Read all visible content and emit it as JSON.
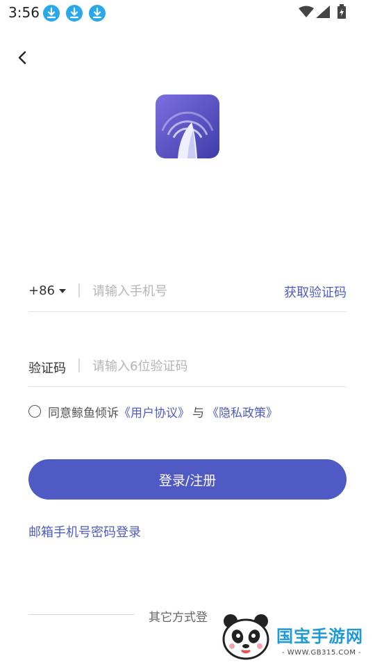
{
  "status_bar": {
    "time": "3:56",
    "icons": [
      "download-icon",
      "download-icon",
      "download-icon",
      "wifi-icon",
      "signal-icon",
      "battery-icon"
    ]
  },
  "nav": {
    "back_icon": "chevron-left-icon"
  },
  "login_form": {
    "country_code": "+86",
    "phone_placeholder": "请输入手机号",
    "get_code_label": "获取验证码",
    "code_label": "验证码",
    "code_placeholder": "请输入6位验证码",
    "agreement": {
      "prefix": "同意鲸鱼倾诉",
      "user_agreement": "《用户协议》",
      "and": "与",
      "privacy_policy": "《隐私政策》"
    },
    "login_button_label": "登录/注册",
    "alt_login_label": "邮箱手机号密码登录"
  },
  "other_methods": {
    "label": "其它方式登"
  },
  "watermark": {
    "brand": "国宝手游网",
    "url": "- WWW.GB315.COM -"
  },
  "colors": {
    "accent": "#505ac5",
    "link": "#4f5bc4",
    "status_download": "#29a9ec"
  }
}
